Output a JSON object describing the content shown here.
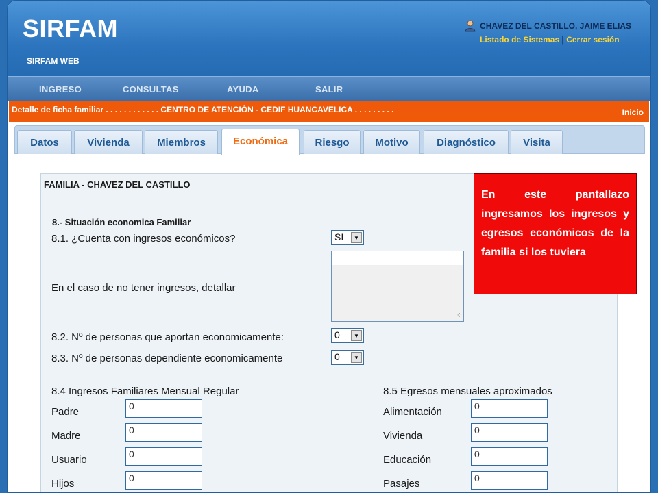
{
  "header": {
    "logo": "SIRFAM",
    "subtitle": "SIRFAM WEB",
    "user_name": "CHAVEZ DEL CASTILLO, JAIME ELIAS",
    "link_systems": "Listado de Sistemas",
    "link_separator": "|",
    "link_logout": "Cerrar sesión"
  },
  "nav": {
    "items": [
      "INGRESO",
      "CONSULTAS",
      "AYUDA",
      "SALIR"
    ]
  },
  "breadcrumb": {
    "text": "Detalle de ficha familiar . . . . . . . . . . . . CENTRO DE ATENCIÓN - CEDIF HUANCAVELICA . . . . . . . . .",
    "home": "Inicio"
  },
  "tabs": {
    "items": [
      "Datos",
      "Vivienda",
      "Miembros",
      "Económica",
      "Riesgo",
      "Motivo",
      "Diagnóstico",
      "Visita"
    ],
    "active": "Económica"
  },
  "form": {
    "family_title": "FAMILIA - CHAVEZ DEL CASTILLO",
    "section_title": "8.- Situación economica Familiar",
    "q81_label": "8.1. ¿Cuenta con ingresos económicos?",
    "q81_value": "SI",
    "no_income_label": "En el caso de no tener ingresos, detallar",
    "q82_label": "8.2. Nº de personas que aportan economicamente:",
    "q82_value": "0",
    "q83_label": "8.3. Nº de personas dependiente economicamente",
    "q83_value": "0",
    "income_title": "8.4 Ingresos Familiares Mensual Regular",
    "income_rows": [
      {
        "label": "Padre",
        "value": "0"
      },
      {
        "label": "Madre",
        "value": "0"
      },
      {
        "label": "Usuario",
        "value": "0"
      },
      {
        "label": "Hijos",
        "value": "0"
      }
    ],
    "expense_title": "8.5 Egresos mensuales aproximados",
    "expense_rows": [
      {
        "label": "Alimentación",
        "value": "0"
      },
      {
        "label": "Vivienda",
        "value": "0"
      },
      {
        "label": "Educación",
        "value": "0"
      },
      {
        "label": "Pasajes",
        "value": "0"
      }
    ]
  },
  "callout": {
    "text": "En este pantallazo ingresamos los ingresos y egresos económicos de la familia si los tuviera"
  },
  "colors": {
    "header_blue": "#2c74bd",
    "breadcrumb_orange": "#ef5a0a",
    "active_tab_text": "#ef6a10",
    "callout_red": "#f10a0a",
    "link_yellow": "#f7d43a"
  }
}
